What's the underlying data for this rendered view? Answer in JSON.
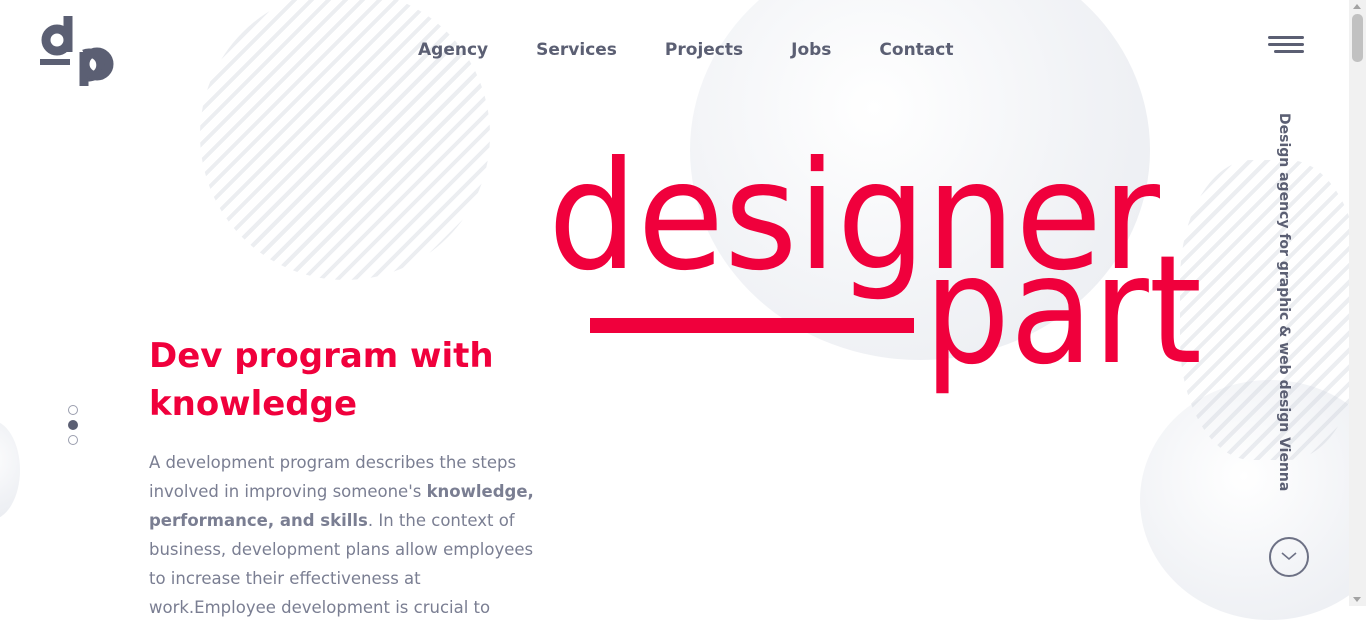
{
  "colors": {
    "accent": "#f0003c",
    "text": "#5b5f73"
  },
  "logo": {
    "text": "dp"
  },
  "nav": {
    "items": [
      {
        "label": "Agency"
      },
      {
        "label": "Services"
      },
      {
        "label": "Projects"
      },
      {
        "label": "Jobs"
      },
      {
        "label": "Contact"
      }
    ]
  },
  "menu": {
    "icon": "hamburger-icon"
  },
  "brand": {
    "line1": "designer",
    "line2": "part"
  },
  "tagline": "Design agency for graphic & web design Vienna",
  "slider": {
    "total": 3,
    "active": 2
  },
  "hero": {
    "title": "Dev program with knowledge",
    "para_start": "A development program describes the steps involved in improving someone's ",
    "para_bold": "knowledge, performance, and skills",
    "para_end": ". In the context of business, development plans allow employees to increase their effectiveness at work.Employee development is crucial to"
  },
  "scroll_down": {
    "icon": "chevron-down-icon"
  }
}
